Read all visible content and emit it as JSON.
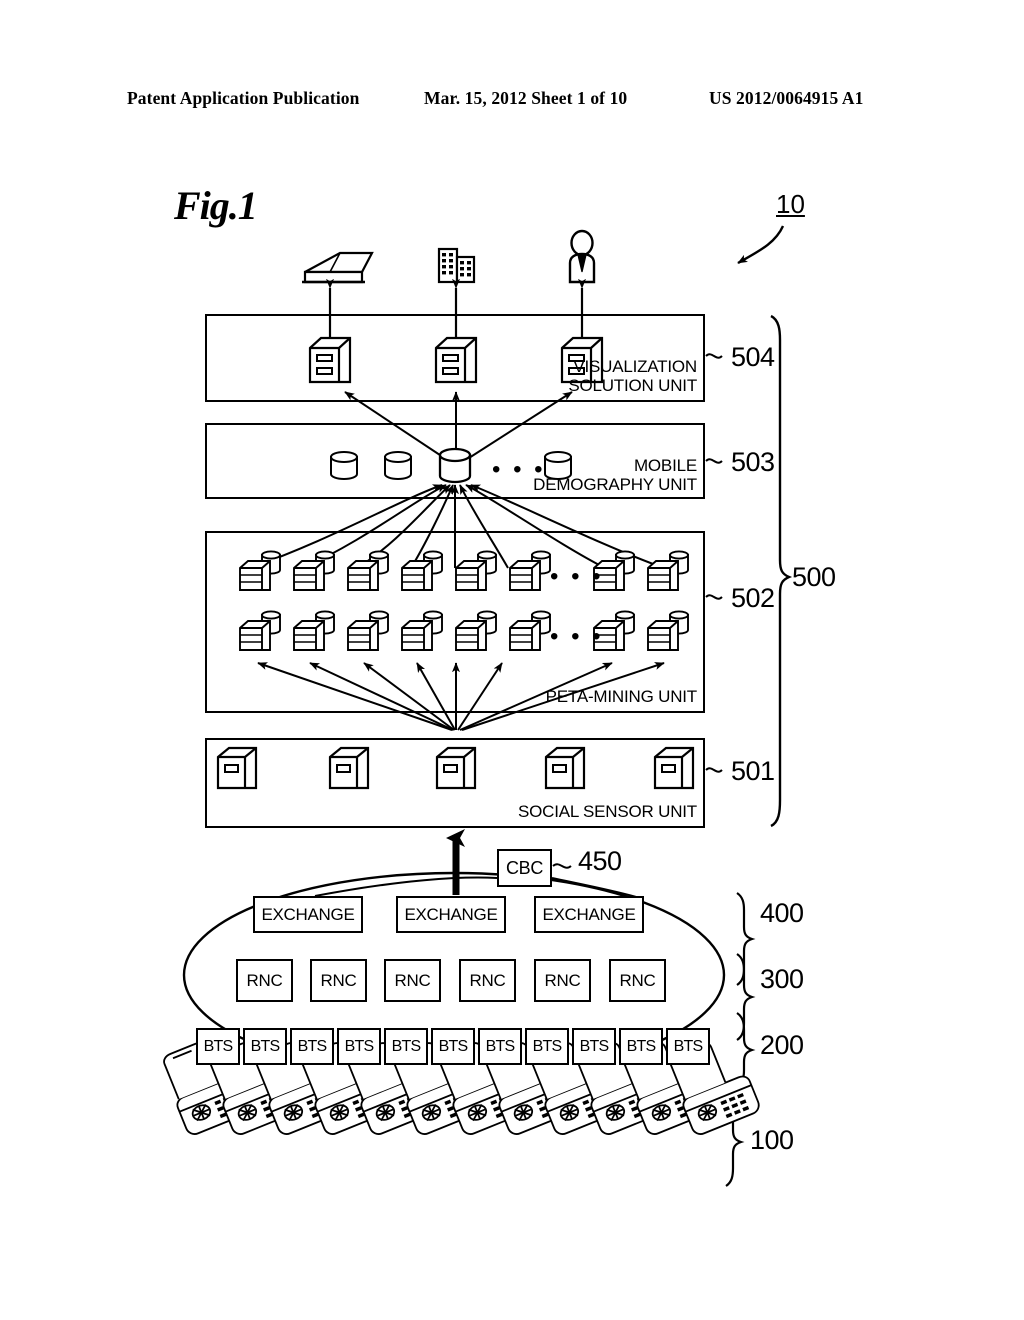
{
  "header": {
    "publication": "Patent Application Publication",
    "date_sheet": "Mar. 15, 2012  Sheet 1 of 10",
    "patent_number": "US 2012/0064915 A1"
  },
  "figure": {
    "label": "Fig.1",
    "system_ref": "10"
  },
  "top_actors": [
    {
      "name": "government-facility-icon",
      "label": ""
    },
    {
      "name": "office-buildings-icon",
      "label": ""
    },
    {
      "name": "person-icon",
      "label": ""
    }
  ],
  "layers": [
    {
      "ref": "504",
      "title": "VISUALIZATION\nSOLUTION UNIT",
      "icon_type": "server-box-two-slot",
      "icon_count": 3
    },
    {
      "ref": "503",
      "title": "MOBILE\nDEMOGRAPHY UNIT",
      "icon_type": "database-cylinder",
      "icon_count": 4,
      "ellipsis": "• • •"
    },
    {
      "ref": "502",
      "title": "PETA-MINING UNIT",
      "icon_type": "server-rack-with-cylinder",
      "rows": 2,
      "icons_per_row": 8,
      "ellipsis": "• • •"
    },
    {
      "ref": "501",
      "title": "SOCIAL SENSOR UNIT",
      "icon_type": "sensor-box-one-slot",
      "icon_count": 5
    }
  ],
  "group_ref": "500",
  "network": {
    "cbc": {
      "label": "CBC",
      "ref": "450"
    },
    "exchange": {
      "label": "EXCHANGE",
      "count": 3,
      "ref": "400"
    },
    "rnc": {
      "label": "RNC",
      "count": 6,
      "ref": "300"
    },
    "bts": {
      "label": "BTS",
      "count": 11,
      "ref": "200"
    },
    "handsets": {
      "count": 12,
      "ref": "100"
    }
  }
}
